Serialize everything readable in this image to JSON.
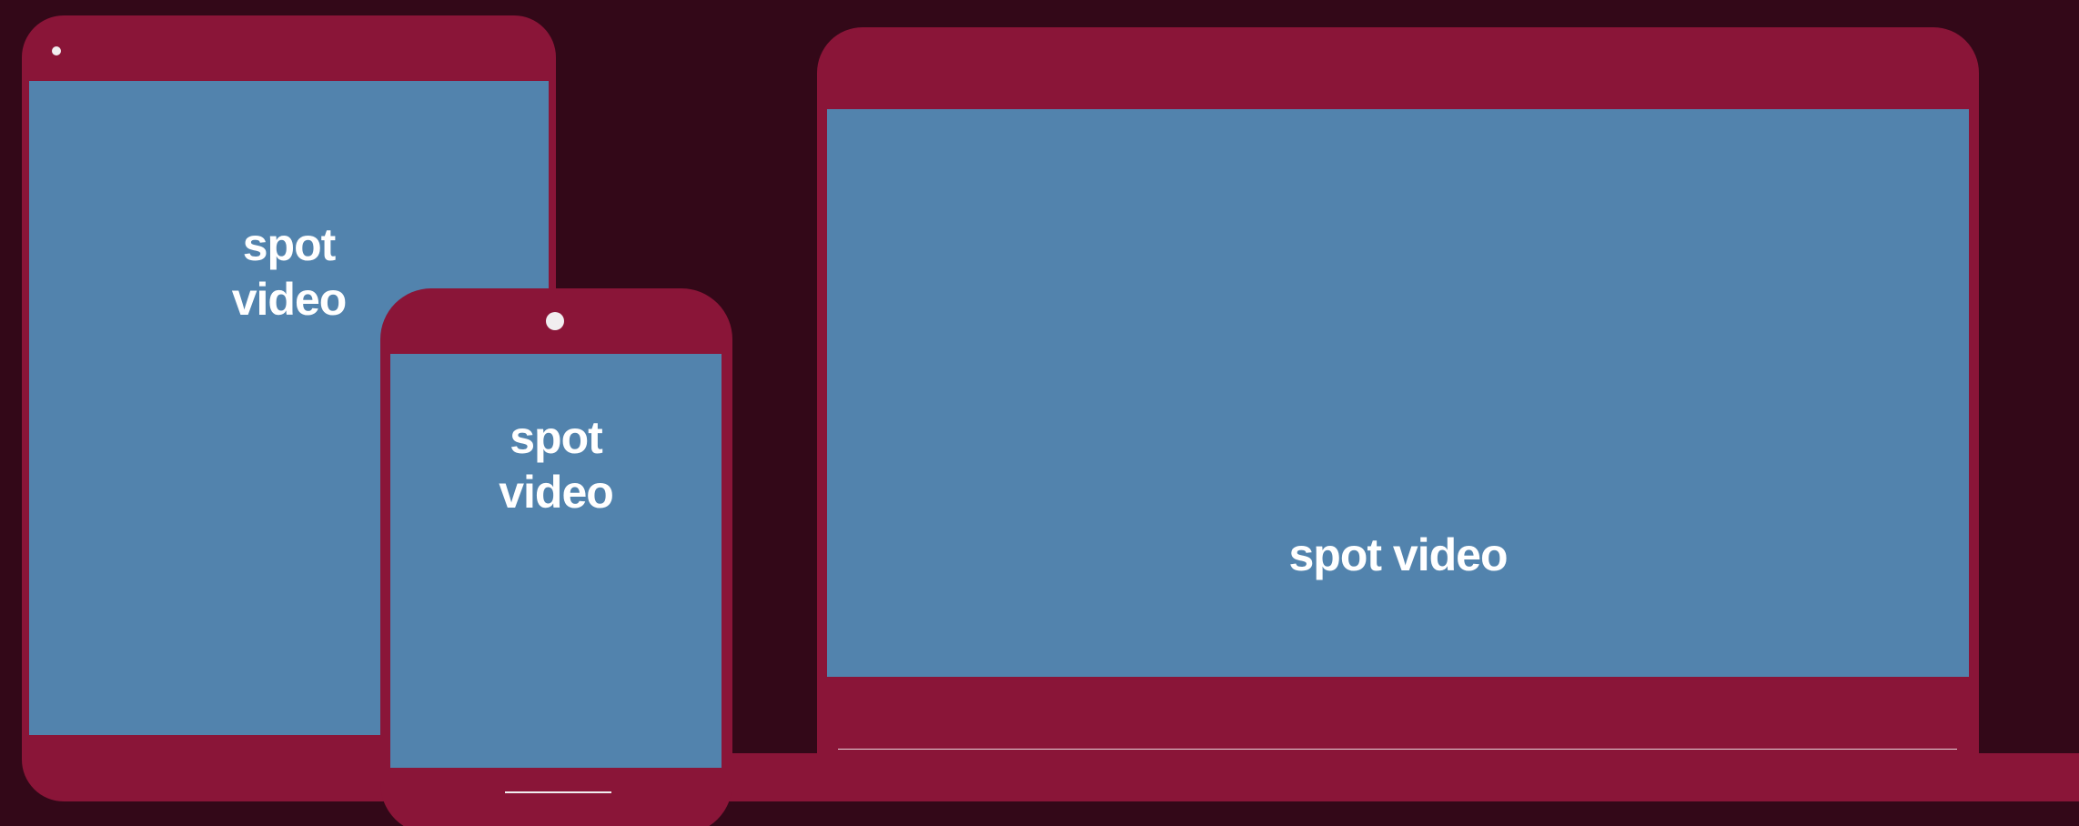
{
  "devices": {
    "tablet": {
      "screen_label": "spot video"
    },
    "phone": {
      "screen_label": "spot video"
    },
    "laptop": {
      "screen_label": "spot video"
    }
  },
  "colors": {
    "background": "#330818",
    "device_frame": "#8a1538",
    "screen": "#5283ad",
    "text": "#ffffff",
    "camera": "#f1eef0"
  }
}
